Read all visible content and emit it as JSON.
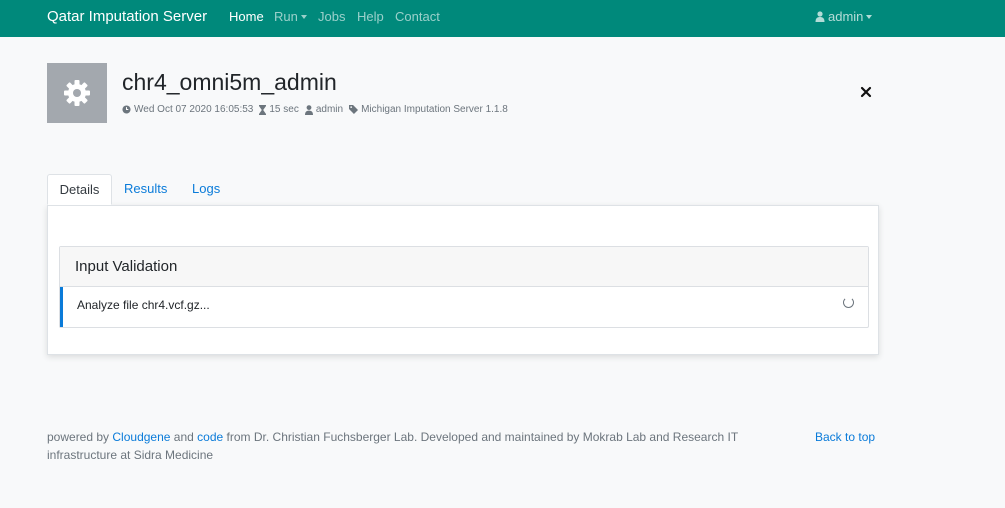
{
  "navbar": {
    "brand": "Qatar Imputation Server",
    "links": [
      "Home",
      "Run",
      "Jobs",
      "Help",
      "Contact"
    ],
    "user": "admin"
  },
  "job": {
    "title": "chr4_omni5m_admin",
    "date": "Wed Oct 07 2020 16:05:53",
    "duration": "15 sec",
    "user": "admin",
    "app": "Michigan Imputation Server 1.1.8"
  },
  "tabs": [
    "Details",
    "Results",
    "Logs"
  ],
  "validation": {
    "header": "Input Validation",
    "message": "Analyze file chr4.vcf.gz..."
  },
  "footer": {
    "text_1": "powered by",
    "link_1": "Cloudgene",
    "text_2": "and",
    "link_2": "code",
    "text_3": "from Dr. Christian Fuchsberger Lab. Developed and maintained by Mokrab Lab and Research IT infrastructure at Sidra Medicine",
    "back_to_top": "Back to top"
  },
  "colors": {
    "navbar": "#00897b",
    "link": "#0a7bd9"
  }
}
